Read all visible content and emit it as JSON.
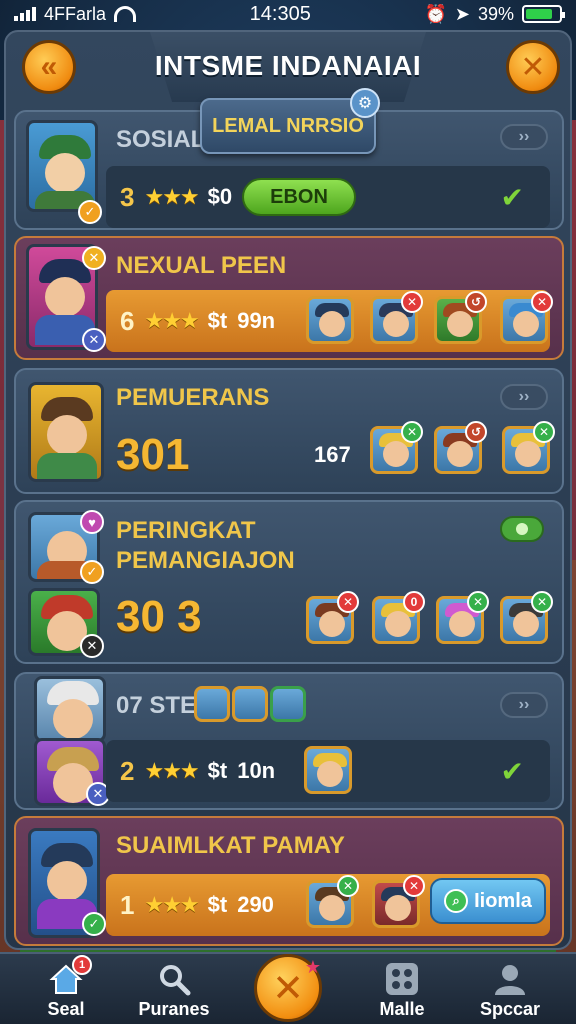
{
  "status_bar": {
    "carrier": "4FFarla",
    "time": "14:305",
    "battery": "39%"
  },
  "header": {
    "title": "INTSME INDANAIAI",
    "tag": "LEMAL NRRSIO"
  },
  "cards": [
    {
      "name": "SOSIAL F",
      "level": "3",
      "price": "$0",
      "button": "EBON"
    },
    {
      "name": "NEXUAL PEEN",
      "level": "6",
      "price": "$t",
      "amount": "99n"
    },
    {
      "name": "PEMUERANS",
      "big": "301",
      "mid": "167"
    },
    {
      "name_line1": "PERINGKAT",
      "name_line2": "PEMANGIAJON",
      "big": "30 3"
    },
    {
      "name": "07 STE",
      "level": "2",
      "price": "$t",
      "amount": "10n"
    },
    {
      "name": "SUAIMLKAT PAMAY",
      "level": "1",
      "price": "$t",
      "amount": "290",
      "button": "Iiomla"
    }
  ],
  "nav": [
    {
      "label": "Seal",
      "badge": "1"
    },
    {
      "label": "Puranes"
    },
    {
      "label": "Malle"
    },
    {
      "label": "Spccar"
    }
  ],
  "colors": {
    "accent_gold": "#f5b733",
    "brand_orange": "#f08b10",
    "panel": "#33475e"
  }
}
